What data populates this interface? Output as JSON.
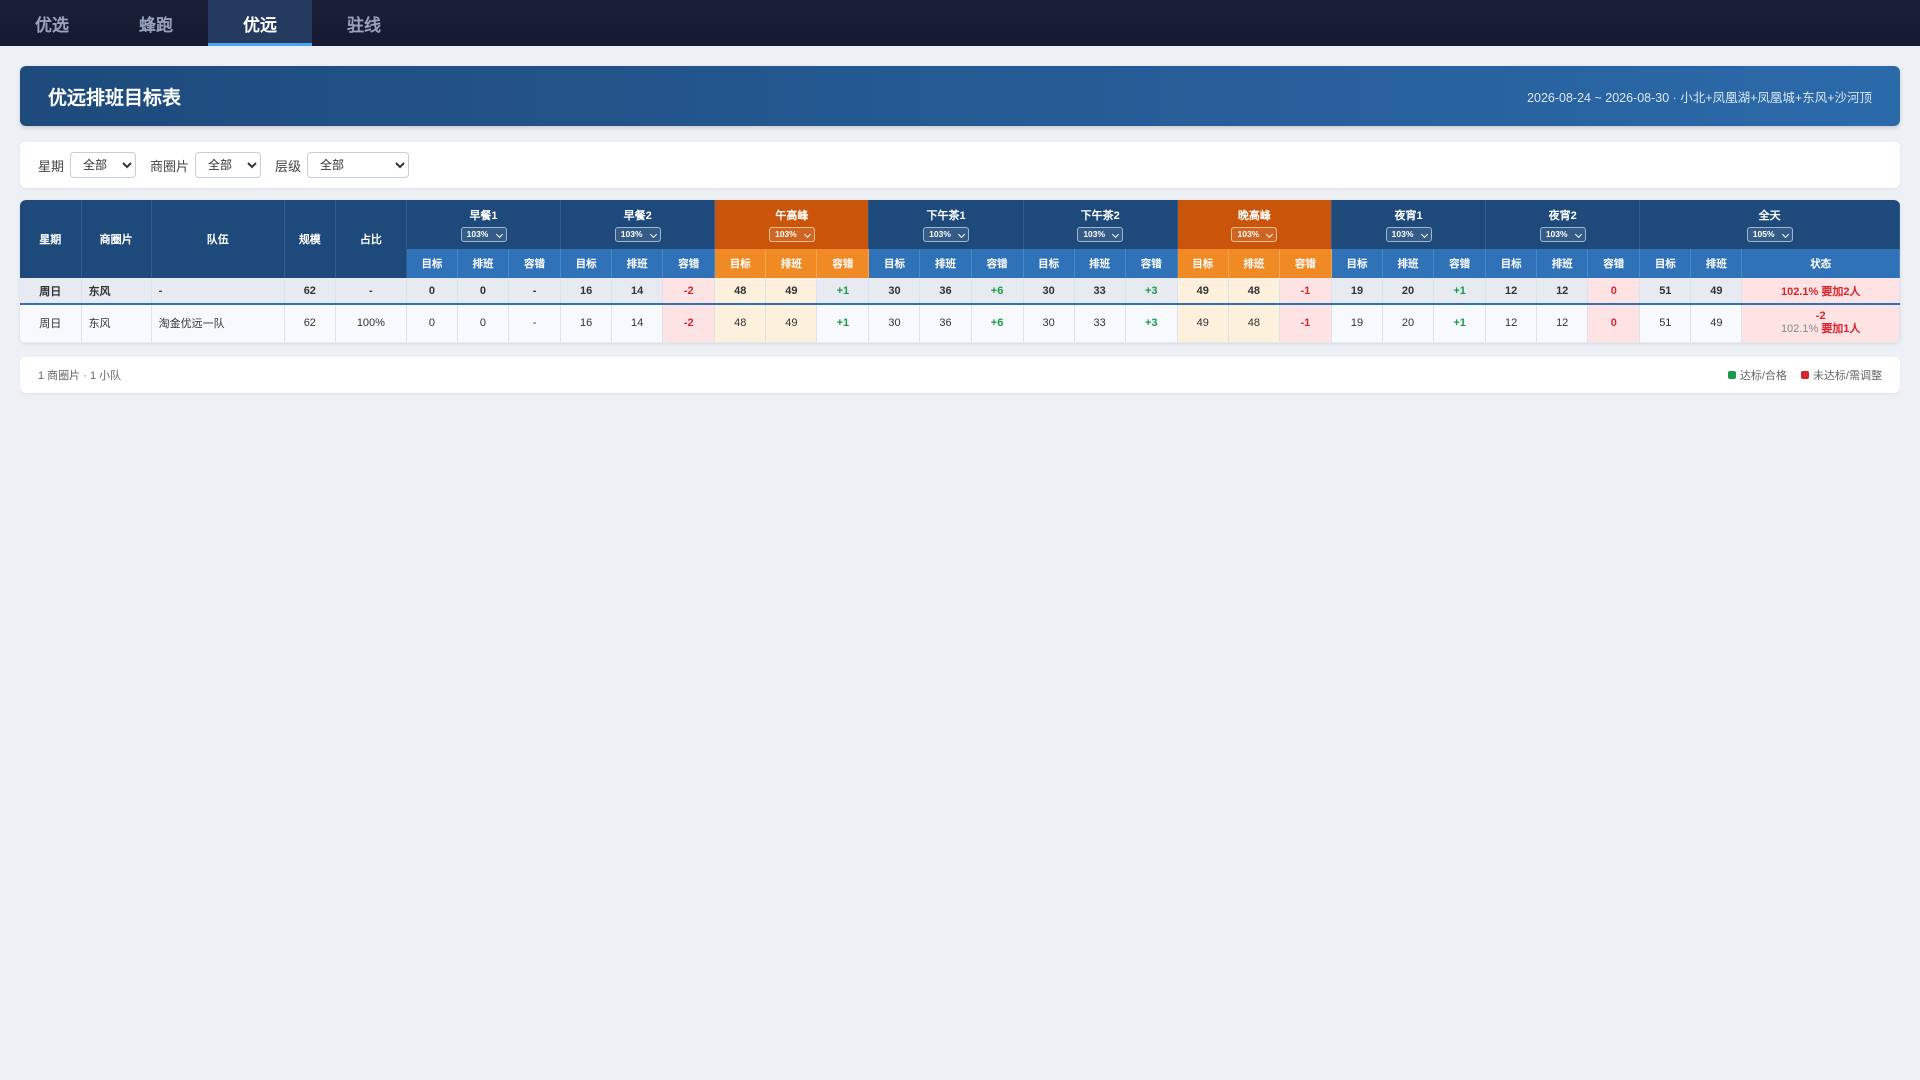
{
  "tabs": [
    {
      "label": "优选"
    },
    {
      "label": "蜂跑"
    },
    {
      "label": "优远"
    },
    {
      "label": "驻线"
    }
  ],
  "banner": {
    "title": "优远排班目标表",
    "subtitle": "2026-08-24 ~ 2026-08-30 · 小北+凤凰湖+凤凰城+东风+沙河顶"
  },
  "filters": {
    "weekday_label": "星期",
    "weekday_value": "全部",
    "area_label": "商圈片",
    "area_value": "全部",
    "level_label": "层级",
    "level_value": "全部"
  },
  "table": {
    "fixed_headers": {
      "weekday": "星期",
      "area": "商圈片",
      "team": "队伍",
      "scale": "规模",
      "ratio": "占比"
    },
    "groups": [
      {
        "name": "早餐1",
        "pct": "103%"
      },
      {
        "name": "早餐2",
        "pct": "103%"
      },
      {
        "name": "午高峰",
        "pct": "103%"
      },
      {
        "name": "下午茶1",
        "pct": "103%"
      },
      {
        "name": "下午茶2",
        "pct": "103%"
      },
      {
        "name": "晚高峰",
        "pct": "103%"
      },
      {
        "name": "夜宵1",
        "pct": "103%"
      },
      {
        "name": "夜宵2",
        "pct": "103%"
      },
      {
        "name": "全天",
        "pct": "105%"
      }
    ],
    "sub_headers": {
      "target": "目标",
      "schedule": "排班",
      "margin": "容错",
      "status": "状态"
    },
    "summary": {
      "weekday": "周日",
      "area": "东风",
      "team": "-",
      "scale": "62",
      "ratio": "-",
      "cells": [
        [
          "0",
          "0",
          "-"
        ],
        [
          "16",
          "14",
          "-2"
        ],
        [
          "48",
          "49",
          "+1"
        ],
        [
          "30",
          "36",
          "+6"
        ],
        [
          "30",
          "33",
          "+3"
        ],
        [
          "49",
          "48",
          "-1"
        ],
        [
          "19",
          "20",
          "+1"
        ],
        [
          "12",
          "12",
          "0"
        ]
      ],
      "day_target": "51",
      "day_schedule": "49",
      "status": "102.1% 要加2人"
    },
    "detail": {
      "weekday": "周日",
      "area": "东风",
      "team": "淘金优远一队",
      "scale": "62",
      "ratio": "100%",
      "cells": [
        [
          "0",
          "0",
          "-"
        ],
        [
          "16",
          "14",
          "-2"
        ],
        [
          "48",
          "49",
          "+1"
        ],
        [
          "30",
          "36",
          "+6"
        ],
        [
          "30",
          "33",
          "+3"
        ],
        [
          "49",
          "48",
          "-1"
        ],
        [
          "19",
          "20",
          "+1"
        ],
        [
          "12",
          "12",
          "0"
        ]
      ],
      "day_target": "51",
      "day_schedule": "49",
      "status_top": "-2",
      "status_pct": "102.1%",
      "status_text": "要加1人"
    }
  },
  "footer": {
    "summary": "1 商圈片 · 1 小队",
    "legend_ok": "达标/合格",
    "legend_bad": "未达标/需调整",
    "ok_color": "#1a9a4a",
    "bad_color": "#d6262d"
  }
}
